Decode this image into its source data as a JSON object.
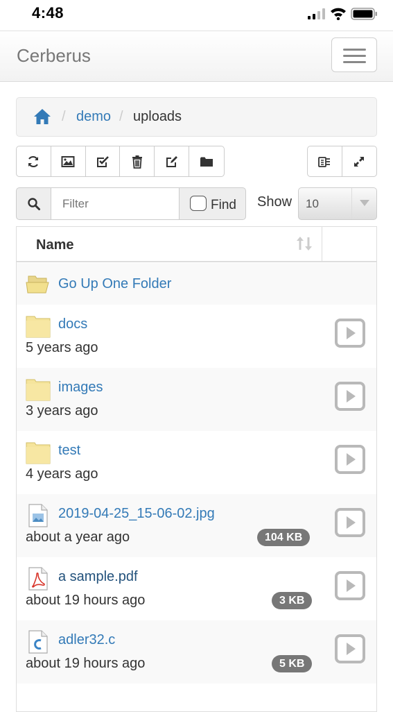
{
  "status_bar": {
    "time": "4:48"
  },
  "app": {
    "brand": "Cerberus"
  },
  "breadcrumb": {
    "separator": "/",
    "items": [
      {
        "label": "demo"
      },
      {
        "label": "uploads"
      }
    ]
  },
  "filter": {
    "placeholder": "Filter",
    "find_label": "Find",
    "show_label": "Show",
    "page_size": "10"
  },
  "table": {
    "header": "Name",
    "go_up": "Go Up One Folder",
    "rows": [
      {
        "name": "docs",
        "age": "5 years ago",
        "size": ""
      },
      {
        "name": "images",
        "age": "3 years ago",
        "size": ""
      },
      {
        "name": "test",
        "age": "4 years ago",
        "size": ""
      },
      {
        "name": "2019-04-25_15-06-02.jpg",
        "age": "about a year ago",
        "size": "104 KB"
      },
      {
        "name": "a sample.pdf",
        "age": "about 19 hours ago",
        "size": "3 KB"
      },
      {
        "name": "adler32.c",
        "age": "about 19 hours ago",
        "size": "5 KB"
      }
    ]
  },
  "colors": {
    "link": "#337ab7",
    "badge": "#777777",
    "folder": "#f5e49c"
  }
}
